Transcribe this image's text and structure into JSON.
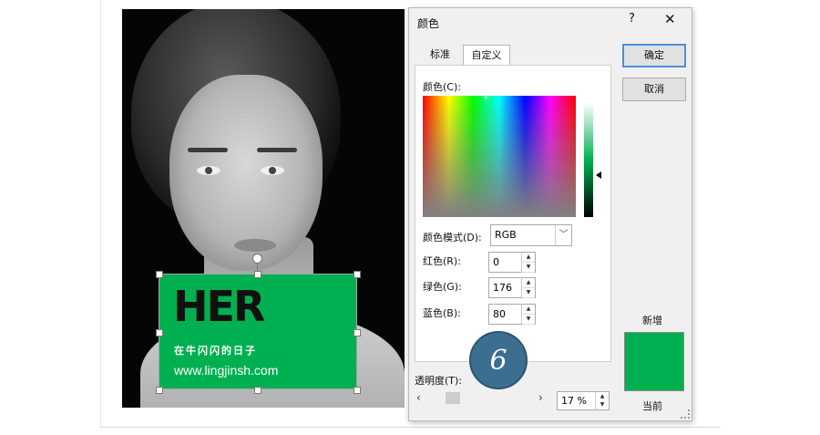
{
  "card": {
    "title": "HER",
    "subtitle": "在牛闪闪的日子",
    "url": "www.lingjinsh.com"
  },
  "dialog": {
    "title": "颜色",
    "help_label": "?",
    "close_label": "✕",
    "tabs": [
      {
        "label": "标准",
        "selected": false
      },
      {
        "label": "自定义",
        "selected": true
      }
    ],
    "colors_label": "颜色(C):",
    "mode_label": "颜色模式(D):",
    "mode_value": "RGB",
    "red_label": "红色(R):",
    "red_value": "0",
    "green_label": "绿色(G):",
    "green_value": "176",
    "blue_label": "蓝色(B):",
    "blue_value": "80",
    "ok_label": "确定",
    "cancel_label": "取消",
    "new_label": "新增",
    "current_label": "当前",
    "transparency_label": "透明度(T):",
    "transparency_value": "17 %",
    "step_badge": "6",
    "current_color": "#00b050"
  }
}
